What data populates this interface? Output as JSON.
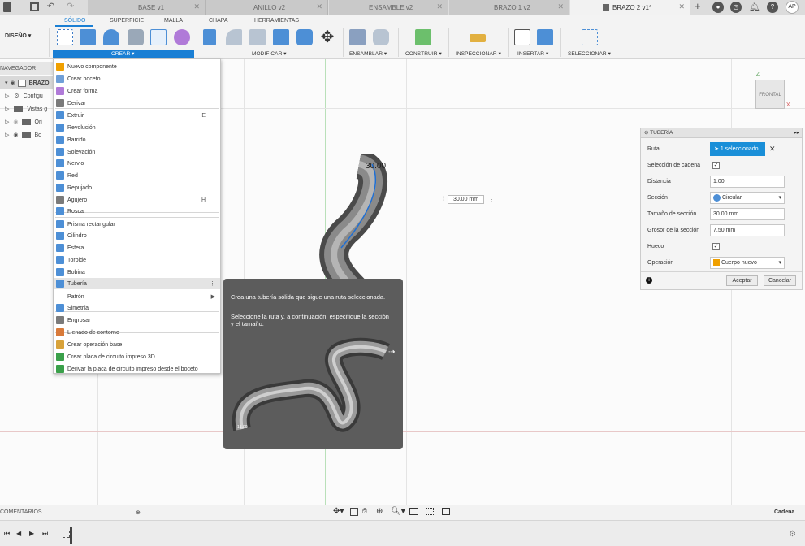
{
  "tabs": [
    {
      "label": "BASE v1"
    },
    {
      "label": "ANILLO v2"
    },
    {
      "label": "ENSAMBLE v2"
    },
    {
      "label": "BRAZO 1 v2"
    },
    {
      "label": "BRAZO 2 v1*"
    }
  ],
  "user": {
    "initials": "AP"
  },
  "workspace": {
    "label": "DISEÑO"
  },
  "context_tabs": [
    "SÓLIDO",
    "SUPERFICIE",
    "MALLA",
    "CHAPA",
    "HERRAMIENTAS"
  ],
  "tool_groups": [
    "CREAR",
    "MODIFICAR",
    "ENSAMBLAR",
    "CONSTRUIR",
    "INSPECCIONAR",
    "INSERTAR",
    "SELECCIONAR"
  ],
  "browser": {
    "title": "NAVEGADOR",
    "root": "BRAZO",
    "items": [
      "Configu",
      "Vistas g",
      "Ori",
      "Bo"
    ]
  },
  "create_menu": [
    {
      "label": "Nuevo componente",
      "icon": "new-component-icon",
      "color": "#f0a000"
    },
    {
      "label": "Crear boceto",
      "icon": "sketch-icon",
      "color": "#6f9fd8"
    },
    {
      "label": "Crear forma",
      "icon": "form-icon",
      "color": "#b07ad8"
    },
    {
      "label": "Derivar",
      "icon": "derive-icon",
      "color": "#7a7a7a"
    },
    {
      "label": "Extruir",
      "icon": "extrude-icon",
      "color": "#4d8fd6",
      "shortcut": "E"
    },
    {
      "label": "Revolución",
      "icon": "revolve-icon",
      "color": "#4d8fd6"
    },
    {
      "label": "Barrido",
      "icon": "sweep-icon",
      "color": "#4d8fd6"
    },
    {
      "label": "Solevación",
      "icon": "loft-icon",
      "color": "#4d8fd6"
    },
    {
      "label": "Nervio",
      "icon": "rib-icon",
      "color": "#4d8fd6"
    },
    {
      "label": "Red",
      "icon": "web-icon",
      "color": "#4d8fd6"
    },
    {
      "label": "Repujado",
      "icon": "emboss-icon",
      "color": "#4d8fd6"
    },
    {
      "label": "Agujero",
      "icon": "hole-icon",
      "color": "#7a7a7a",
      "shortcut": "H"
    },
    {
      "label": "Rosca",
      "icon": "thread-icon",
      "color": "#4d8fd6"
    },
    {
      "label": "Prisma rectangular",
      "icon": "box-icon",
      "color": "#4d8fd6"
    },
    {
      "label": "Cilindro",
      "icon": "cylinder-icon",
      "color": "#4d8fd6"
    },
    {
      "label": "Esfera",
      "icon": "sphere-icon",
      "color": "#4d8fd6"
    },
    {
      "label": "Toroide",
      "icon": "torus-icon",
      "color": "#4d8fd6"
    },
    {
      "label": "Bobina",
      "icon": "coil-icon",
      "color": "#4d8fd6"
    },
    {
      "label": "Tubería",
      "icon": "pipe-icon",
      "color": "#4d8fd6"
    },
    {
      "label": "Patrón",
      "icon": "pattern-icon",
      "color": "#ffffff",
      "submenu": "▶"
    },
    {
      "label": "Simetría",
      "icon": "mirror-icon",
      "color": "#4d8fd6"
    },
    {
      "label": "Engrosar",
      "icon": "thicken-icon",
      "color": "#7a7a7a"
    },
    {
      "label": "Llenado de contorno",
      "icon": "boundary-fill-icon",
      "color": "#d87a3a"
    },
    {
      "label": "Crear operación base",
      "icon": "base-feature-icon",
      "color": "#d8a23a"
    },
    {
      "label": "Crear placa de circuito impreso 3D",
      "icon": "pcb-icon",
      "color": "#3aa04a"
    },
    {
      "label": "Derivar la placa de circuito impreso desde el boceto",
      "icon": "pcb-derive-icon",
      "color": "#3aa04a"
    }
  ],
  "viewport": {
    "dimension_label": "30.00",
    "dimension_input": "30.00 mm",
    "viewcube_face": "FRONTAL",
    "axis_z": "Z",
    "axis_x": "X"
  },
  "tooltip": {
    "line1": "Crea una tubería sólida que sigue una ruta seleccionada.",
    "line2": "Seleccione la ruta y, a continuación, especifique la sección y el tamaño.",
    "preview_label": "15.00"
  },
  "pipe_panel": {
    "title": "TUBERÍA",
    "fields": {
      "path_label": "Ruta",
      "path_value": "1 seleccionado",
      "chain_label": "Selección de cadena",
      "distance_label": "Distancia",
      "distance_value": "1.00",
      "section_label": "Sección",
      "section_value": "Circular",
      "size_label": "Tamaño de sección",
      "size_value": "30.00 mm",
      "thickness_label": "Grosor de la sección",
      "thickness_value": "7.50 mm",
      "hollow_label": "Hueco",
      "operation_label": "Operación",
      "operation_value": "Cuerpo nuevo"
    },
    "ok": "Aceptar",
    "cancel": "Cancelar"
  },
  "bottom": {
    "comments": "COMENTARIOS",
    "mode": "Cadena"
  }
}
